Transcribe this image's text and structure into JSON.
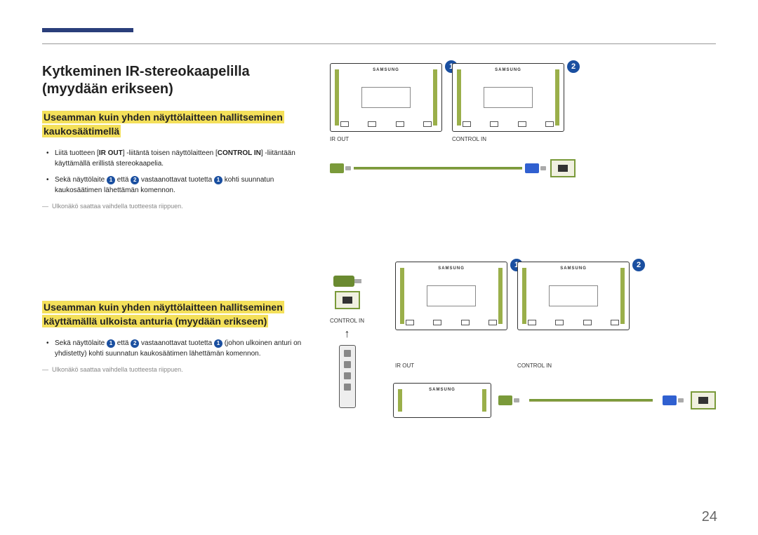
{
  "page_number": "24",
  "title": "Kytkeminen IR-stereokaapelilla (myydään erikseen)",
  "section1": {
    "subtitle_line1": "Useamman kuin yhden näyttölaitteen hallitseminen",
    "subtitle_line2": "kaukosäätimellä",
    "bullet1_pre": "Liitä tuotteen [",
    "bullet1_b1": "IR OUT",
    "bullet1_mid": "] -liitäntä toisen näyttölaitteen [",
    "bullet1_b2": "CONTROL IN",
    "bullet1_post": "] -liitäntään käyttämällä erillistä stereokaapelia.",
    "bullet2_pre": "Sekä näyttölaite ",
    "bullet2_mid1": " että ",
    "bullet2_mid2": " vastaanottavat tuotetta ",
    "bullet2_post": " kohti suunnatun kaukosäätimen lähettämän komennon.",
    "note": "Ulkonäkö saattaa vaihdella tuotteesta riippuen."
  },
  "section2": {
    "subtitle_line1": "Useamman kuin yhden näyttölaitteen hallitseminen",
    "subtitle_line2": "käyttämällä ulkoista anturia (myydään erikseen)",
    "bullet1_pre": "Sekä näyttölaite ",
    "bullet1_mid1": " että ",
    "bullet1_mid2": " vastaanottavat tuotetta ",
    "bullet1_post": " (johon ulkoinen anturi on yhdistetty) kohti suunnatun kaukosäätimen lähettämän komennon.",
    "note": "Ulkonäkö saattaa vaihdella tuotteesta riippuen."
  },
  "labels": {
    "ir_out": "IR OUT",
    "control_in": "CONTROL IN",
    "brand": "SAMSUNG",
    "one": "1",
    "two": "2"
  }
}
